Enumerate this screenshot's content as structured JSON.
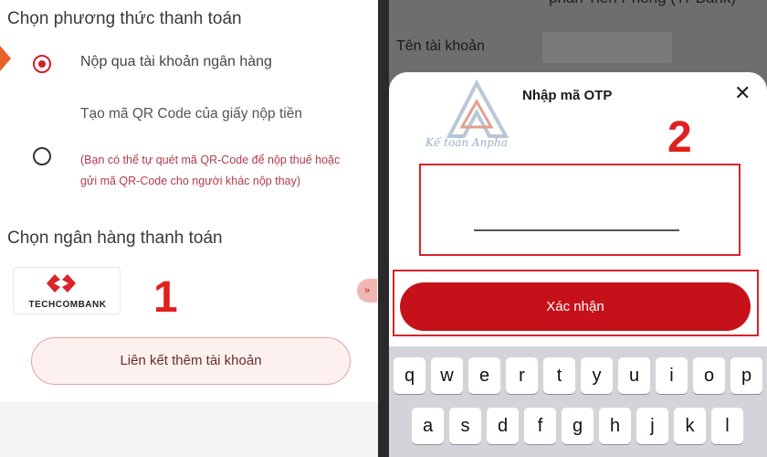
{
  "left": {
    "payment_method_heading": "Chọn phương thức thanh toán",
    "option1_label": "Nộp qua tài khoản ngân hàng",
    "option2_label": "Tạo mã QR Code của giấy nộp tiền",
    "option2_note": "(Bạn có thể tự quét mã QR-Code để nộp thuế hoặc gửi mã QR-Code cho người khác nộp thay)",
    "bank_heading": "Chọn ngân hàng thanh toán",
    "bank_name": "TECHCOMBANK",
    "step_number": "1",
    "link_account_button": "Liên kết thêm tài khoản",
    "side_arrow": "»"
  },
  "right": {
    "bank_name_partial": "phần Tiền Phong (TPBank)",
    "account_name_label": "Tên tài khoản",
    "otp_title": "Nhập mã OTP",
    "close_symbol": "✕",
    "step_number": "2",
    "confirm_button": "Xác nhận",
    "watermark_text": "Kế toán Anpha",
    "keyboard_row1": [
      "q",
      "w",
      "e",
      "r",
      "t",
      "y",
      "u",
      "i",
      "o",
      "p"
    ],
    "keyboard_row2": [
      "a",
      "s",
      "d",
      "f",
      "g",
      "h",
      "j",
      "k",
      "l"
    ]
  },
  "colors": {
    "accent_red": "#c7111a",
    "highlight_red": "#d8242a",
    "step_number_red": "#e0201f"
  }
}
